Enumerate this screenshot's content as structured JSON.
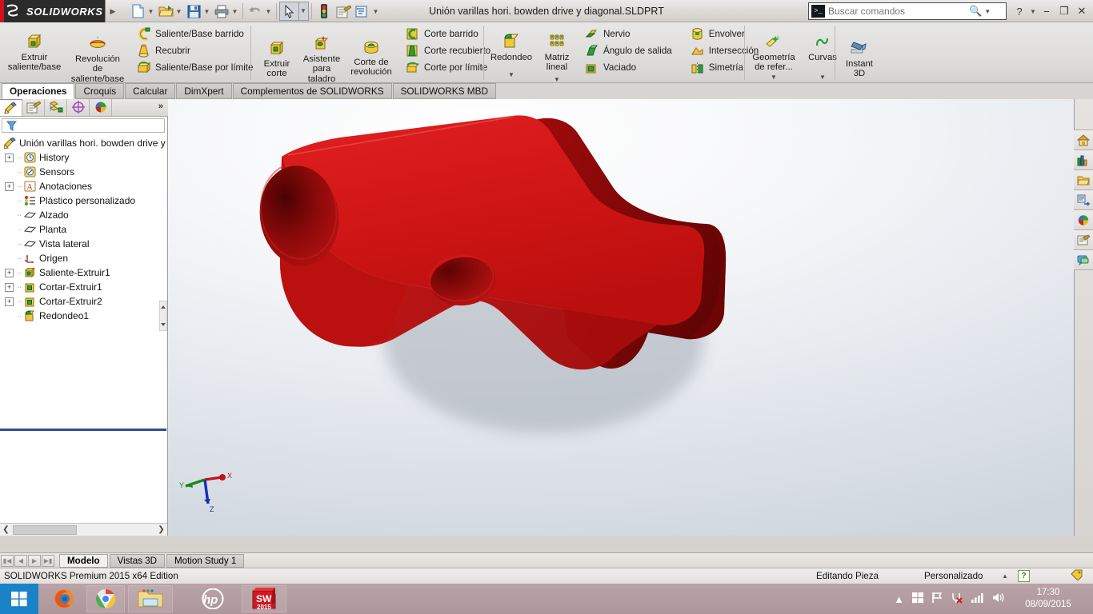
{
  "titlebar": {
    "brand": "SOLIDWORKS",
    "document_title": "Unión varillas hori. bowden drive y diagonal.SLDPRT",
    "quick_access": [
      {
        "name": "new-document",
        "icon": "new-doc-icon",
        "caret": true
      },
      {
        "name": "open-document",
        "icon": "open-folder-icon",
        "caret": true
      },
      {
        "name": "save-document",
        "icon": "save-disk-icon",
        "caret": true
      },
      {
        "name": "print-document",
        "icon": "printer-icon",
        "caret": true
      },
      {
        "name": "undo",
        "icon": "undo-arrow-icon",
        "caret": true
      },
      {
        "name": "select",
        "icon": "cursor-arrow-icon",
        "caret": true
      },
      {
        "name": "rebuild",
        "icon": "traffic-light-icon",
        "caret": false
      },
      {
        "name": "file-properties",
        "icon": "properties-icon",
        "caret": false
      },
      {
        "name": "options",
        "icon": "options-gear-icon",
        "caret": true
      }
    ],
    "search": {
      "placeholder": "Buscar comandos",
      "value": "",
      "icon": "command-search-icon"
    },
    "window_buttons": [
      "help-icon",
      "help-caret",
      "minimize-icon",
      "restore-icon",
      "close-icon"
    ]
  },
  "ribbon": {
    "groups": [
      {
        "name": "boss-base",
        "big": [
          {
            "label": "Extruir\nsaliente/base",
            "icon": "extrude-boss-icon",
            "caret": false
          },
          {
            "label": "Revolución\nde\nsaliente/base",
            "icon": "revolve-boss-icon",
            "caret": false
          }
        ],
        "small": [
          {
            "label": "Saliente/Base barrido",
            "icon": "swept-boss-icon"
          },
          {
            "label": "Recubrir",
            "icon": "loft-boss-icon"
          },
          {
            "label": "Saliente/Base por límite",
            "icon": "boundary-boss-icon"
          }
        ]
      },
      {
        "name": "cut",
        "big": [
          {
            "label": "Extruir\ncorte",
            "icon": "extrude-cut-icon",
            "caret": false
          },
          {
            "label": "Asistente\npara\ntaladro",
            "icon": "hole-wizard-icon",
            "caret": false
          },
          {
            "label": "Corte de\nrevolución",
            "icon": "revolve-cut-icon",
            "caret": false
          }
        ],
        "small": [
          {
            "label": "Corte barrido",
            "icon": "swept-cut-icon"
          },
          {
            "label": "Corte recubierto",
            "icon": "lofted-cut-icon"
          },
          {
            "label": "Corte por límite",
            "icon": "boundary-cut-icon"
          }
        ]
      },
      {
        "name": "features",
        "big": [
          {
            "label": "Redondeo",
            "icon": "fillet-icon",
            "caret": true
          },
          {
            "label": "Matriz\nlineal",
            "icon": "linear-pattern-icon",
            "caret": true
          }
        ],
        "small": [
          {
            "label": "Nervio",
            "icon": "rib-icon"
          },
          {
            "label": "Ángulo de salida",
            "icon": "draft-icon"
          },
          {
            "label": "Vaciado",
            "icon": "shell-icon"
          }
        ],
        "small2": [
          {
            "label": "Envolver",
            "icon": "wrap-icon"
          },
          {
            "label": "Intersección",
            "icon": "intersect-icon"
          },
          {
            "label": "Simetría",
            "icon": "mirror-icon"
          }
        ]
      },
      {
        "name": "reference",
        "big": [
          {
            "label": "Geometría\nde refer...",
            "icon": "reference-geometry-icon",
            "caret": true
          },
          {
            "label": "Curvas",
            "icon": "curves-icon",
            "caret": true
          }
        ]
      },
      {
        "name": "instant3d",
        "big": [
          {
            "label": "Instant\n3D",
            "icon": "instant3d-icon",
            "caret": false
          }
        ]
      }
    ]
  },
  "tabs": {
    "items": [
      {
        "label": "Operaciones",
        "active": true
      },
      {
        "label": "Croquis",
        "active": false
      },
      {
        "label": "Calcular",
        "active": false
      },
      {
        "label": "DimXpert",
        "active": false
      },
      {
        "label": "Complementos de SOLIDWORKS",
        "active": false
      },
      {
        "label": "SOLIDWORKS MBD",
        "active": false
      }
    ]
  },
  "view_toolbar": {
    "items": [
      {
        "name": "zoom-to-fit-icon",
        "caret": false
      },
      {
        "name": "zoom-to-area-icon",
        "caret": false
      },
      {
        "name": "previous-view-icon",
        "caret": false
      },
      {
        "name": "section-view-icon",
        "caret": false
      },
      {
        "name": "view-orientation-icon",
        "caret": false
      },
      {
        "name": "display-style-icon",
        "caret": true
      },
      {
        "name": "hide-show-items-icon",
        "caret": true
      },
      {
        "name": "edit-appearance-icon",
        "caret": false
      },
      {
        "name": "apply-scene-icon",
        "caret": true
      },
      {
        "name": "view-settings-icon",
        "caret": true
      }
    ]
  },
  "window_controls": [
    "split-horizontal-icon",
    "split-vertical-icon",
    "minimize-icon",
    "restore-icon",
    "close-icon"
  ],
  "feature_manager": {
    "tabs": [
      {
        "name": "feature-manager-tab",
        "active": true
      },
      {
        "name": "property-manager-tab",
        "active": false
      },
      {
        "name": "configuration-manager-tab",
        "active": false
      },
      {
        "name": "dimxpert-manager-tab",
        "active": false
      },
      {
        "name": "display-manager-tab",
        "active": false
      }
    ],
    "more_label": "»",
    "filter_icon": "filter-funnel-icon",
    "filter_value": "",
    "tree": [
      {
        "label": "Unión varillas hori. bowden drive y",
        "icon": "part-icon",
        "depth": 0,
        "expand": "none",
        "selected": false
      },
      {
        "label": "History",
        "icon": "history-clock-icon",
        "depth": 1,
        "expand": "plus",
        "selected": false
      },
      {
        "label": "Sensors",
        "icon": "sensors-icon",
        "depth": 1,
        "expand": "none",
        "selected": false
      },
      {
        "label": "Anotaciones",
        "icon": "annotations-icon",
        "depth": 1,
        "expand": "plus",
        "selected": false
      },
      {
        "label": "Plástico personalizado",
        "icon": "material-icon",
        "depth": 1,
        "expand": "none",
        "selected": false
      },
      {
        "label": "Alzado",
        "icon": "plane-icon",
        "depth": 1,
        "expand": "none",
        "selected": false
      },
      {
        "label": "Planta",
        "icon": "plane-icon",
        "depth": 1,
        "expand": "none",
        "selected": false
      },
      {
        "label": "Vista lateral",
        "icon": "plane-icon",
        "depth": 1,
        "expand": "none",
        "selected": false
      },
      {
        "label": "Origen",
        "icon": "origin-icon",
        "depth": 1,
        "expand": "none",
        "selected": false
      },
      {
        "label": "Saliente-Extruir1",
        "icon": "extrude-boss-icon",
        "depth": 1,
        "expand": "plus",
        "selected": false
      },
      {
        "label": "Cortar-Extruir1",
        "icon": "extrude-cut-icon",
        "depth": 1,
        "expand": "plus",
        "selected": false
      },
      {
        "label": "Cortar-Extruir2",
        "icon": "extrude-cut-icon",
        "depth": 1,
        "expand": "plus",
        "selected": false
      },
      {
        "label": "Redondeo1",
        "icon": "fillet-icon",
        "depth": 1,
        "expand": "none",
        "selected": false
      }
    ]
  },
  "viewport": {
    "model_color": "#cc0000",
    "background_top": "#ffffff",
    "background_bottom": "#cfd6de",
    "triad_labels": {
      "x": "X",
      "y": "Y",
      "z": "Z"
    },
    "triad_colors": {
      "x": "#cc0000",
      "y": "#008000",
      "z": "#0000cc"
    }
  },
  "task_pane": {
    "buttons": [
      {
        "name": "sw-resources-icon"
      },
      {
        "name": "design-library-icon"
      },
      {
        "name": "file-explorer-icon"
      },
      {
        "name": "view-palette-icon"
      },
      {
        "name": "appearances-scenes-icon"
      },
      {
        "name": "custom-properties-icon"
      },
      {
        "name": "sw-forum-icon"
      }
    ]
  },
  "bottom_tabs": {
    "nav": [
      "first-icon",
      "previous-icon",
      "next-icon",
      "last-icon"
    ],
    "items": [
      {
        "label": "Modelo",
        "active": true
      },
      {
        "label": "Vistas 3D",
        "active": false
      },
      {
        "label": "Motion Study 1",
        "active": false
      }
    ]
  },
  "status_bar": {
    "edition": "SOLIDWORKS Premium 2015 x64 Edition",
    "editing": "Editando Pieza",
    "units": "Personalizado",
    "caret": "▲",
    "help_badge": "?",
    "tag_icon": "tag-icon"
  },
  "taskbar": {
    "start": {
      "name": "windows-start-icon"
    },
    "items": [
      {
        "name": "firefox-icon",
        "framed": false
      },
      {
        "name": "chrome-icon",
        "framed": true
      },
      {
        "name": "file-explorer-icon",
        "framed": true
      },
      {
        "name": "hp-icon",
        "framed": false
      },
      {
        "name": "solidworks-2015-icon",
        "framed": true,
        "label": "2015"
      }
    ],
    "tray": [
      {
        "name": "show-hidden-icons-icon"
      },
      {
        "name": "windows-action-center-icon"
      },
      {
        "name": "flag-icon"
      },
      {
        "name": "network-disconnected-icon"
      },
      {
        "name": "signal-bars-icon"
      },
      {
        "name": "volume-icon"
      }
    ],
    "clock_time": "17:30",
    "clock_date": "08/09/2015"
  }
}
